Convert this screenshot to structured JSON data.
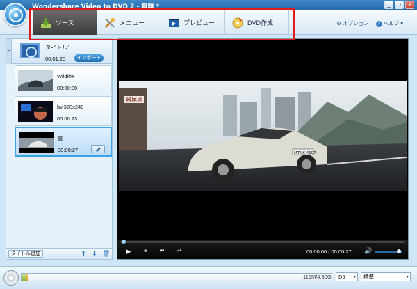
{
  "window": {
    "title": "Wondershare Video to DVD 2 - 無題 *",
    "controls": [
      "_",
      "□",
      "x"
    ]
  },
  "tabs": [
    {
      "label": "ソース",
      "icon": "download-icon",
      "active": true
    },
    {
      "label": "メニュー",
      "icon": "tools-icon",
      "active": false
    },
    {
      "label": "プレビュー",
      "icon": "film-play-icon",
      "active": false
    },
    {
      "label": "DVD作成",
      "icon": "dvd-burn-icon",
      "active": false
    }
  ],
  "toplinks": {
    "options": "オプション",
    "help": "ヘルプ",
    "help_arrow": "▾",
    "gear_glyph": "⚙",
    "help_glyph": "?"
  },
  "title_group": {
    "collapse": "−",
    "name": "タイトル1",
    "duration": "00:01:20",
    "import_label": "インポート"
  },
  "clips": [
    {
      "name": "Wildlife",
      "duration": "00:00:30"
    },
    {
      "name": "bvi320x240",
      "duration": "00:00:23"
    },
    {
      "name": "車",
      "duration": "00:00:27",
      "selected": true
    }
  ],
  "left_footer": {
    "add_title": "タイトル追加",
    "up": "⬆",
    "down": "⬇",
    "delete": "🗑"
  },
  "player": {
    "play": "▶",
    "stop": "■",
    "prev": "⏮",
    "next": "⏭",
    "current": "00:00:00",
    "separator": "/",
    "total": "00:00:27",
    "volume": "🔊",
    "scene_sign": "雅尾酒",
    "plate": "MTNK 4597"
  },
  "bottom": {
    "capacity": "116M/4.30G",
    "disc_type": "D5",
    "quality": "標準",
    "dropdown_arrow": "▾"
  },
  "colors": {
    "accent": "#2f78c2",
    "highlight": "#e01b1b",
    "active_tab": "#4a4a4a"
  }
}
